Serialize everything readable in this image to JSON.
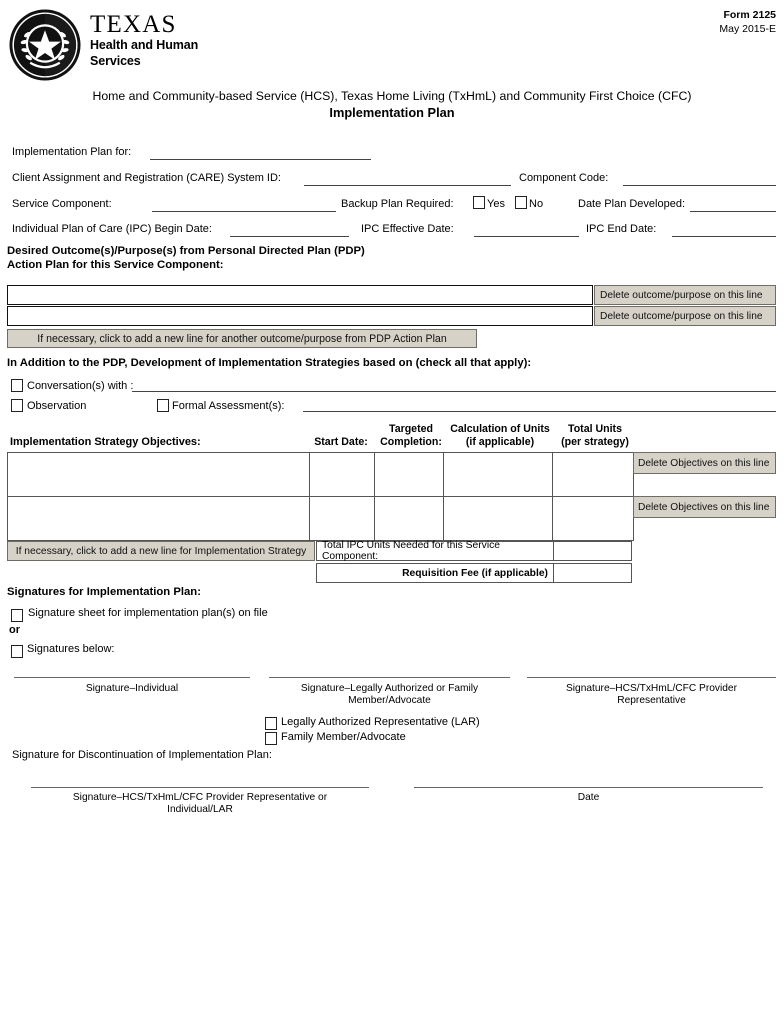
{
  "header": {
    "form_number": "Form 2125",
    "form_date": "May 2015-E",
    "agency_name": "TEXAS",
    "agency_sub_line1": "Health and Human",
    "agency_sub_line2": "Services",
    "program_line": "Home and Community-based Service (HCS), Texas Home Living (TxHmL) and Community First Choice (CFC)",
    "title": "Implementation Plan"
  },
  "fields": {
    "implementation_plan_for": "Implementation Plan for:",
    "care_system_id": "Client Assignment and Registration (CARE) System ID:",
    "component_code": "Component Code:",
    "service_component": "Service Component:",
    "backup_plan_required": "Backup Plan Required:",
    "yes": "Yes",
    "no": "No",
    "date_plan_developed": "Date Plan Developed:",
    "ipc_begin_date": "Individual Plan of Care (IPC) Begin Date:",
    "ipc_effective_date": "IPC Effective Date:",
    "ipc_end_date": "IPC End Date:"
  },
  "pdp_section": {
    "heading_line1": "Desired Outcome(s)/Purpose(s) from Personal Directed Plan (PDP)",
    "heading_line2": "Action Plan for this Service Component:",
    "rows": [
      {
        "value": "",
        "delete_label": "Delete outcome/purpose on this line"
      },
      {
        "value": "",
        "delete_label": "Delete outcome/purpose on this line"
      }
    ],
    "add_line_label": "If necessary, click to add a new line for another outcome/purpose from PDP Action Plan"
  },
  "strategies_basis": {
    "heading": "In Addition to the PDP, Development of Implementation Strategies based on (check all that apply):",
    "conversations_label": "Conversation(s) with :",
    "conversations_value": "",
    "observation_label": "Observation",
    "formal_assessment_label": "Formal Assessment(s):",
    "formal_assessment_value": ""
  },
  "strategy_table": {
    "col_objectives": "Implementation Strategy Objectives:",
    "col_start_date": "Start Date:",
    "col_targeted_completion_line1": "Targeted",
    "col_targeted_completion_line2": "Completion:",
    "col_calculation_line1": "Calculation of Units",
    "col_calculation_line2": "(if applicable)",
    "col_total_units_line1": "Total Units",
    "col_total_units_line2": "(per strategy)",
    "rows": [
      {
        "objective": "",
        "start_date": "",
        "targeted_completion": "",
        "calculation": "",
        "total_units": "",
        "delete_label": "Delete Objectives on this line"
      },
      {
        "objective": "",
        "start_date": "",
        "targeted_completion": "",
        "calculation": "",
        "total_units": "",
        "delete_label": "Delete Objectives on this line"
      }
    ],
    "add_line_label": "If necessary, click to add a new line for Implementation Strategy",
    "total_ipc_units_label": "Total IPC Units Needed for this Service Component:",
    "total_ipc_units_value": "",
    "requisition_fee_label": "Requisition Fee (if applicable)",
    "requisition_fee_value": ""
  },
  "signatures": {
    "heading": "Signatures for Implementation Plan:",
    "on_file_label": "Signature sheet for implementation plan(s) on file",
    "or_label": "or",
    "below_label": "Signatures below:",
    "caption_individual": "Signature–Individual",
    "caption_lar_line1": "Signature–Legally Authorized or Family",
    "caption_lar_line2": "Member/Advocate",
    "caption_provider_line1": "Signature–HCS/TxHmL/CFC Provider",
    "caption_provider_line2": "Representative",
    "lar_checkbox_label": "Legally Authorized Representative (LAR)",
    "family_checkbox_label": "Family Member/Advocate",
    "discontinuation_label": "Signature for Discontinuation of Implementation Plan:",
    "caption_disc_line1": "Signature–HCS/TxHmL/CFC Provider Representative or",
    "caption_disc_line2": "Individual/LAR",
    "caption_date": "Date"
  },
  "colors": {
    "button_bg": "#d6d2c8",
    "button_border": "#6f6c66",
    "rule": "#444444"
  }
}
